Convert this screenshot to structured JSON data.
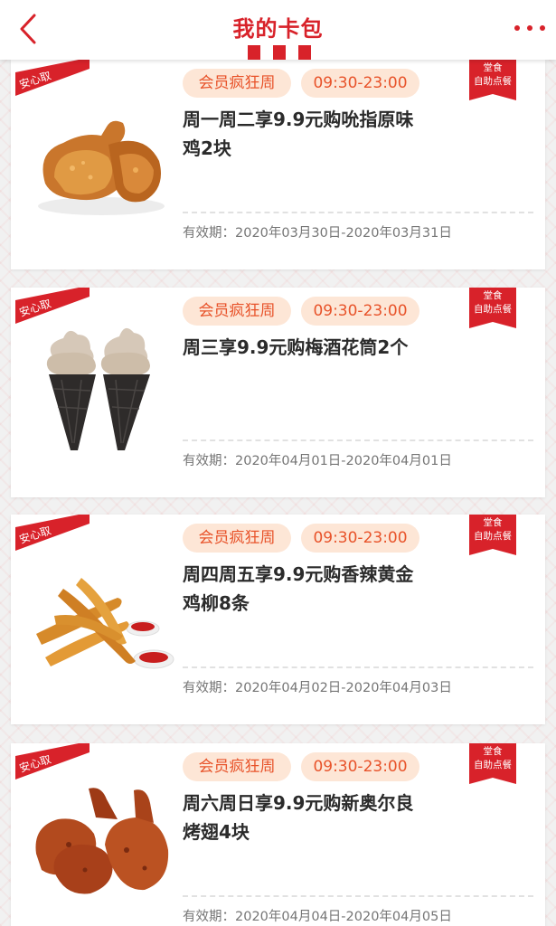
{
  "header": {
    "title": "我的卡包",
    "back_icon": "chevron-left-icon",
    "more_icon": "more-dots-icon"
  },
  "colors": {
    "brand_red": "#d8222a",
    "pill_bg": "#fde6d6",
    "pill_text": "#e8532a"
  },
  "coupons": [
    {
      "safe_label": "安心取",
      "tag": "会员疯狂周",
      "time": "09:30-23:00",
      "badge_line1": "堂食",
      "badge_line2": "自助点餐",
      "title": "周一周二享9.9元购吮指原味鸡2块",
      "validity_label": "有效期：",
      "validity": "2020年03月30日-2020年03月31日",
      "image": "fried-chicken-image"
    },
    {
      "safe_label": "安心取",
      "tag": "会员疯狂周",
      "time": "09:30-23:00",
      "badge_line1": "堂食",
      "badge_line2": "自助点餐",
      "title": "周三享9.9元购梅酒花筒2个",
      "validity_label": "有效期：",
      "validity": "2020年04月01日-2020年04月01日",
      "image": "ice-cream-cone-image"
    },
    {
      "safe_label": "安心取",
      "tag": "会员疯狂周",
      "time": "09:30-23:00",
      "badge_line1": "堂食",
      "badge_line2": "自助点餐",
      "title": "周四周五享9.9元购香辣黄金鸡柳8条",
      "validity_label": "有效期：",
      "validity": "2020年04月02日-2020年04月03日",
      "image": "chicken-strips-image"
    },
    {
      "safe_label": "安心取",
      "tag": "会员疯狂周",
      "time": "09:30-23:00",
      "badge_line1": "堂食",
      "badge_line2": "自助点餐",
      "title": "周六周日享9.9元购新奥尔良烤翅4块",
      "validity_label": "有效期：",
      "validity": "2020年04月04日-2020年04月05日",
      "image": "roast-wings-image"
    }
  ]
}
